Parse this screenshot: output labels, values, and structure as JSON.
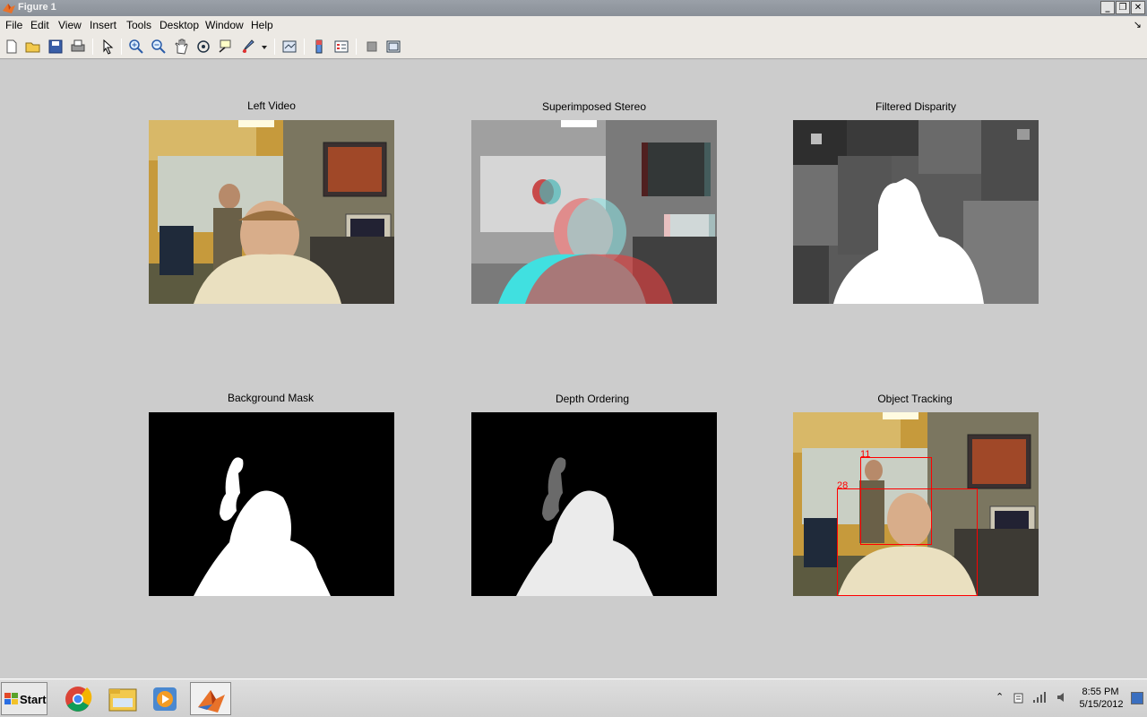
{
  "window": {
    "title": "Figure 1"
  },
  "window_controls": {
    "minimize": "_",
    "maximize": "❐",
    "close": "✕"
  },
  "menu": [
    "File",
    "Edit",
    "View",
    "Insert",
    "Tools",
    "Desktop",
    "Window",
    "Help"
  ],
  "menu_dock": "↘",
  "toolbar": {
    "items": [
      "new-figure-icon",
      "open-file-icon",
      "save-icon",
      "print-icon",
      "edit-plot-icon",
      "zoom-in-icon",
      "zoom-out-icon",
      "pan-icon",
      "rotate-3d-icon",
      "data-cursor-icon",
      "brush-icon",
      "link-plot-icon",
      "insert-colorbar-icon",
      "insert-legend-icon",
      "hide-plot-tools-icon",
      "show-plot-tools-icon"
    ]
  },
  "panels": [
    {
      "title": "Left Video"
    },
    {
      "title": "Superimposed Stereo"
    },
    {
      "title": "Filtered Disparity"
    },
    {
      "title": "Background Mask"
    },
    {
      "title": "Depth Ordering"
    },
    {
      "title": "Object Tracking",
      "track_labels": [
        "11",
        "28"
      ]
    }
  ],
  "colors": {
    "figure_bg": "#cccccc",
    "track_box": "#ff0000",
    "mask_fg": "#ffffff",
    "mask_bg": "#000000"
  },
  "taskbar": {
    "start_label": "Start",
    "apps": [
      "chrome-icon",
      "file-explorer-icon",
      "media-player-icon",
      "matlab-icon"
    ],
    "clock_time": "8:55 PM",
    "clock_date": "5/15/2012"
  }
}
